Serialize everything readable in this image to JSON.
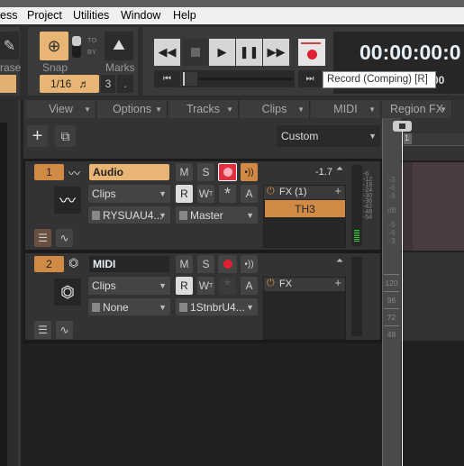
{
  "menu": [
    "ess",
    "Project",
    "Utilities",
    "Window",
    "Help"
  ],
  "toolbar": {
    "erase_label": "rase",
    "snap_label": "Snap",
    "snap_value": "1/16",
    "to_label": "TO",
    "by_label": "BY",
    "marks_label": "Marks",
    "marks_value": "3",
    "marks_dot": ".",
    "time": "00:00:00:0",
    "time_sub": "00",
    "tooltip": "Record (Comping) [R]"
  },
  "tabs": [
    "View",
    "Options",
    "Tracks",
    "Clips",
    "MIDI",
    "Region FX"
  ],
  "track_view": {
    "preset": "Custom",
    "ruler_marker": "1"
  },
  "tracks": [
    {
      "number": "1",
      "name": "Audio",
      "type": "audio",
      "mute": "M",
      "solo": "S",
      "read": "R",
      "write": "W",
      "write_sub": "T",
      "auto": "A",
      "star": "*",
      "volume": "-1.7",
      "mode": "Clips",
      "input": "RYSUAU4...",
      "output": "Master",
      "fx_label": "FX (1)",
      "fx_plugins": [
        "TH3"
      ],
      "armed": true,
      "echo_active": true,
      "meter_scale": [
        "-6",
        "-12",
        "-18",
        "-24",
        "-30",
        "-36",
        "-42",
        "-48",
        "-54"
      ]
    },
    {
      "number": "2",
      "name": "MIDI",
      "type": "midi",
      "mute": "M",
      "solo": "S",
      "read": "R",
      "write": "W",
      "write_sub": "T",
      "auto": "A",
      "star": "*",
      "mode": "Clips",
      "input": "None",
      "output": "1StnbrU4...",
      "fx_label": "FX",
      "fx_plugins": [],
      "armed": false,
      "echo_active": false
    }
  ],
  "ruler_scale_audio": [
    "-3",
    "-6",
    "-9",
    "dB",
    "-9",
    "-6",
    "-3"
  ],
  "ruler_scale_midi": [
    "120",
    "96",
    "72",
    "48"
  ],
  "colors": {
    "accent": "#d08a45",
    "record": "#e03040",
    "background": "#202020"
  }
}
